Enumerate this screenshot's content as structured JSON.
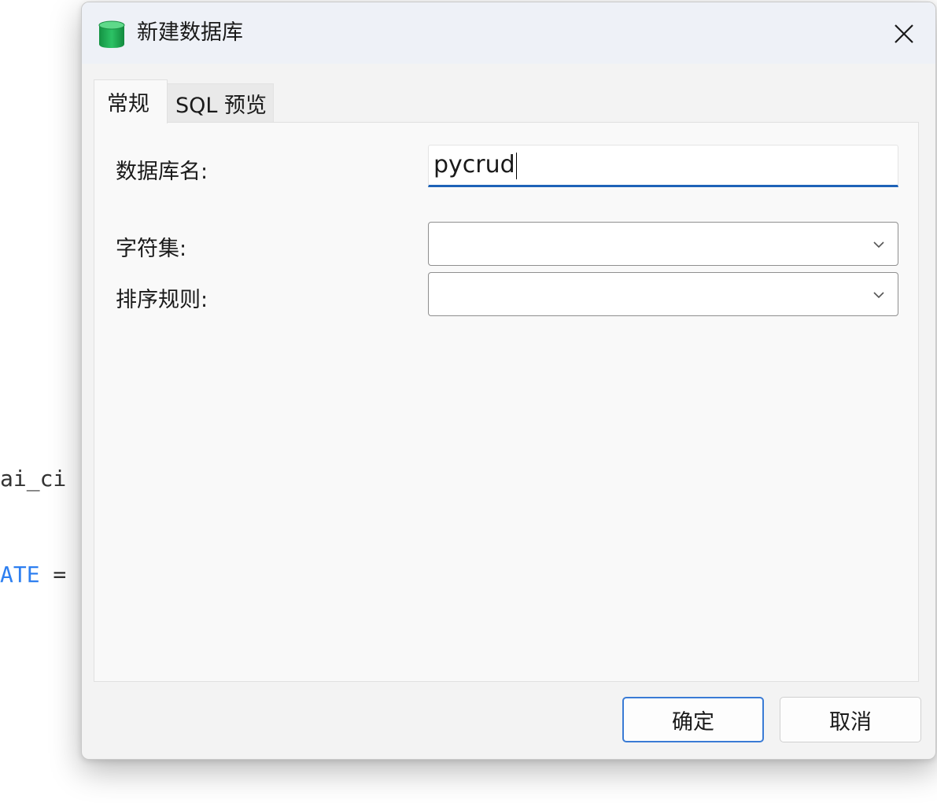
{
  "background": {
    "line1": "ai_ci",
    "line2_keyword": "ATE",
    "line2_rest": " ="
  },
  "dialog": {
    "title": "新建数据库",
    "icon": "database-icon",
    "close_icon": "close-icon"
  },
  "tabs": [
    {
      "label": "常规",
      "active": true
    },
    {
      "label": "SQL 预览",
      "active": false
    }
  ],
  "form": {
    "db_name_label": "数据库名:",
    "db_name_value": "pycrud",
    "charset_label": "字符集:",
    "charset_value": "",
    "collation_label": "排序规则:",
    "collation_value": ""
  },
  "buttons": {
    "ok_label": "确定",
    "cancel_label": "取消"
  },
  "colors": {
    "accent": "#1e63b8",
    "icon_green": "#1fa352"
  }
}
